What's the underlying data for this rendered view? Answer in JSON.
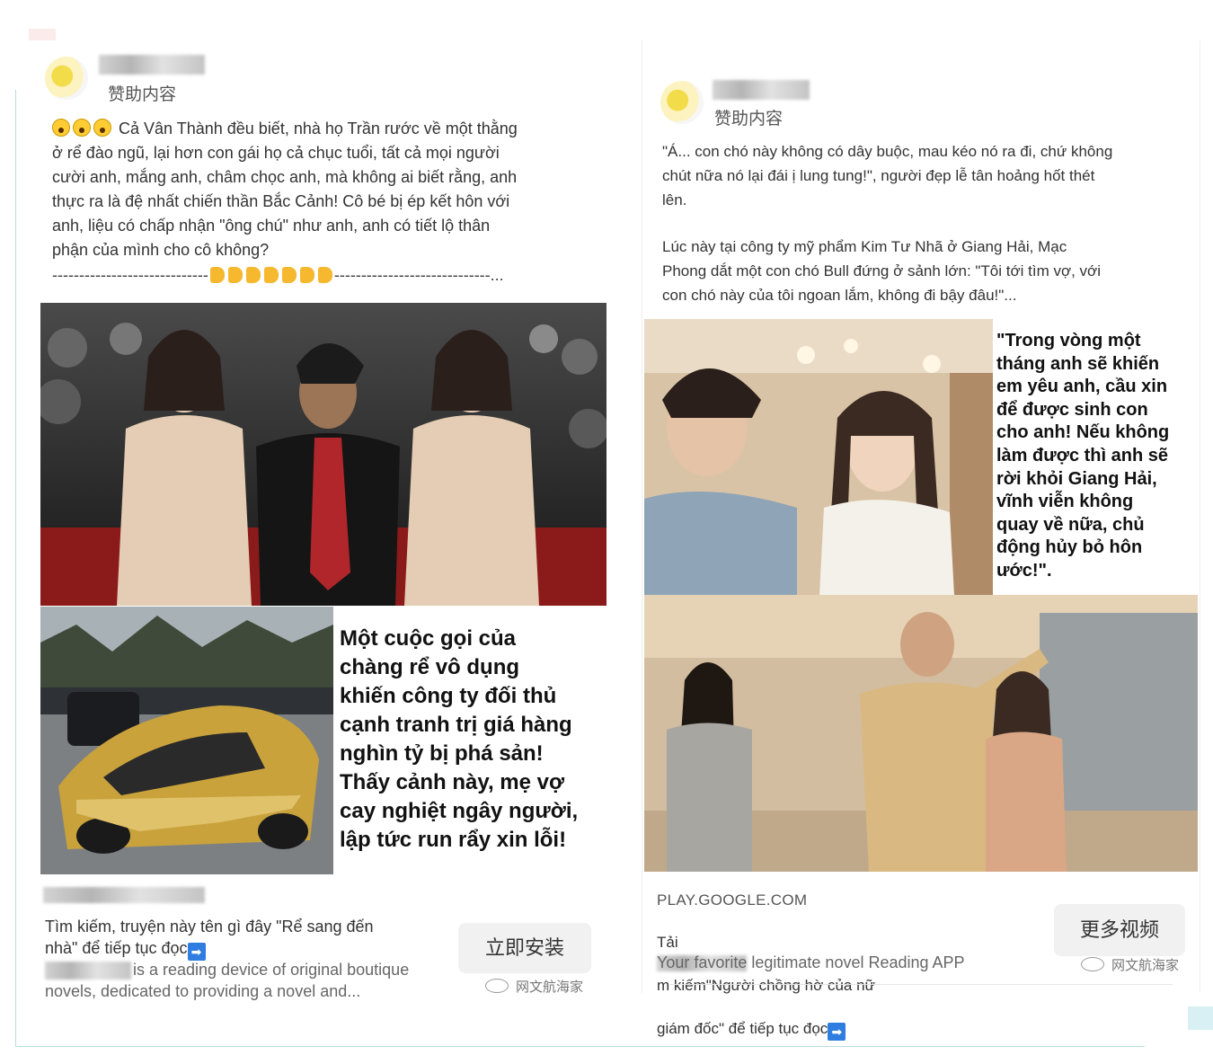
{
  "ad_left": {
    "sponsored_label": "赞助内容",
    "text": "Cả Vân Thành đều biết, nhà họ Trần rước về một thằng\nở rể đào ngũ, lại hơn con gái họ cả chục tuổi, tất cả mọi người\ncười anh, mắng anh, châm chọc anh, mà không ai biết rằng, anh\nthực ra là đệ nhất chiến thần Bắc Cảnh! Cô bé bị ép kết hôn với\nanh, liệu có chấp nhận \"ông chú\" như anh, anh có tiết lộ thân\nphận của mình cho cô không?",
    "dashes_left": "-----------------------------",
    "dashes_right": "-----------------------------...",
    "image_caption": "Một cuộc gọi của\nchàng rể vô dụng\nkhiến công ty đối thủ\ncạnh tranh trị giá hàng\nnghìn tỷ bị phá sản!\nThấy cảnh này, mẹ vợ\ncay nghiệt ngây người,\nlập tức run rẩy xin lỗi!",
    "footer_title": "Tìm kiếm, truyện này tên gì đây \"Rể sang đến\nnhà\" để tiếp tục đọc",
    "footer_desc_1": "is a reading device of original boutique",
    "footer_desc_2": "novels, dedicated to providing a novel and...",
    "cta_label": "立即安装",
    "watermark": "网文航海家"
  },
  "ad_right": {
    "sponsored_label": "赞助内容",
    "text_1": "\"Á... con chó này không có dây buộc, mau kéo nó ra đi, chứ không\nchút nữa nó lại đái ị lung tung!\", người đẹp lễ tân hoảng hốt thét\nlên.",
    "text_2": "Lúc này tại công ty mỹ phẩm Kim Tư Nhã ở Giang Hải, Mạc\nPhong dắt một con chó Bull đứng ở sảnh lớn: \"Tôi tới tìm vợ, với\ncon chó này của tôi ngoan lắm, không đi bậy đâu!\"...",
    "image_caption": "\"Trong vòng một\ntháng anh sẽ khiến\nem yêu anh, cầu xin\nđể được sinh con\ncho anh! Nếu không\nlàm được thì anh sẽ\nrời khỏi Giang Hải,\nvĩnh viễn không\nquay về nữa, chủ\nđộng hủy bỏ hôn\nước!\".",
    "footer_url": "PLAY.GOOGLE.COM",
    "footer_title_a": "Tải",
    "footer_title_b": "m kiếm\"Người chồng hờ của nữ",
    "footer_title_c": "giám đốc\" để tiếp tục đọc",
    "footer_desc": "Your favorite legitimate novel Reading APP",
    "cta_label": "更多视频",
    "watermark": "网文航海家"
  },
  "colors": {
    "accent_blue": "#2f7de1",
    "frame": "#b9dcdc",
    "cta_bg": "#f1f1f1"
  },
  "icons": [
    "avatar",
    "scream-emoji-icon",
    "pointing-hand-icon",
    "right-arrow-icon",
    "wechat-watermark-icon"
  ]
}
